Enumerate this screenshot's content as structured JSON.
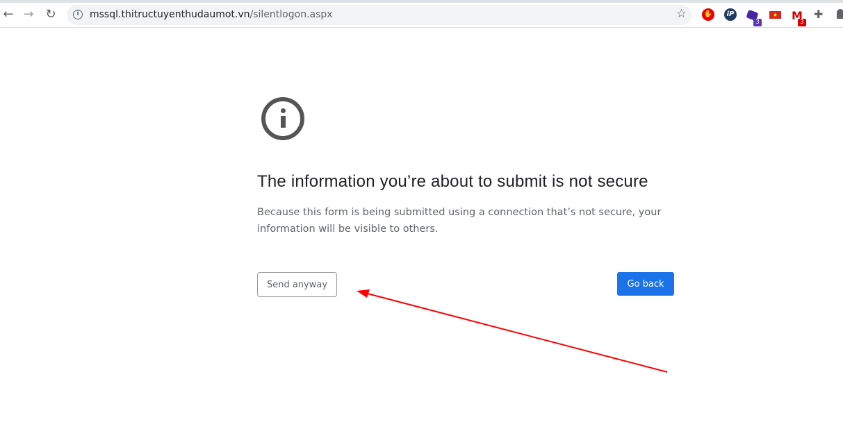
{
  "browser": {
    "url_domain": "mssql.thitructuyenthudaumot.vn",
    "url_path": "/silentlogon.aspx",
    "extensions": [
      {
        "name": "adblock",
        "color": "#e00"
      },
      {
        "name": "ip",
        "label": "iP",
        "color": "#1e3a5f"
      },
      {
        "name": "purple-ext",
        "badge": "3",
        "color": "#4527a0"
      },
      {
        "name": "vietnam-flag",
        "color": "#da251d"
      },
      {
        "name": "gmail",
        "badge": "3",
        "color": "#d50000"
      },
      {
        "name": "extensions-puzzle"
      }
    ]
  },
  "interstitial": {
    "title": "The information you’re about to submit is not secure",
    "description": "Because this form is being submitted using a connection that’s not secure, your information will be visible to others.",
    "send_anyway": "Send anyway",
    "go_back": "Go back",
    "accent": "#1a73e8"
  },
  "annotation": {
    "type": "arrow",
    "color": "#ff0000",
    "points_to": "send-anyway-button"
  }
}
